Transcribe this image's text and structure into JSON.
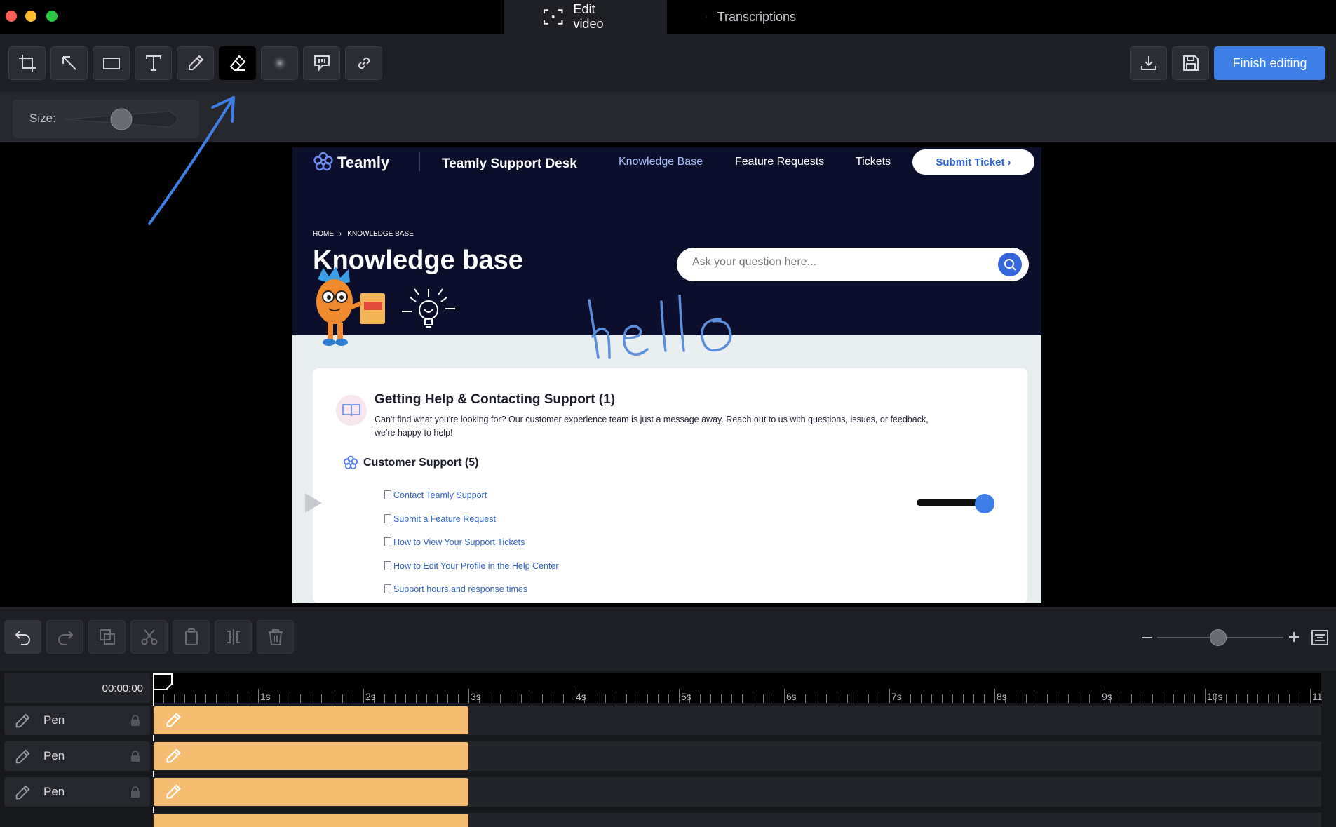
{
  "window": {
    "tabs": [
      {
        "label": "Edit video",
        "icon": "screen-capture-icon",
        "active": true
      },
      {
        "label": "Transcriptions",
        "icon": "transcript-icon",
        "active": false
      }
    ]
  },
  "toolbar": {
    "tools": [
      "crop-icon",
      "arrow-icon",
      "rectangle-icon",
      "text-icon",
      "pen-icon",
      "eraser-icon",
      "blur-icon",
      "callout-icon",
      "link-icon"
    ],
    "active_tool": "eraser-icon",
    "finish_label": "Finish editing"
  },
  "size_control": {
    "label": "Size:"
  },
  "video": {
    "brand": "Teamly",
    "site_title": "Teamly Support Desk",
    "nav": [
      "Knowledge Base",
      "Feature Requests",
      "Tickets"
    ],
    "submit_label": "Submit Ticket ›",
    "breadcrumb_home": "HOME",
    "breadcrumb_sep": "›",
    "breadcrumb_current": "KNOWLEDGE BASE",
    "page_heading": "Knowledge base",
    "search_placeholder": "Ask your question here...",
    "annotation_text": "hello",
    "section": {
      "title": "Getting Help & Contacting Support (1)",
      "desc_line1": "Can't find what you're looking for? Our customer experience team is just a message away. Reach out to us with questions, issues, or feedback,",
      "desc_line2": "we're happy to help!"
    },
    "category": {
      "title": "Customer Support (5)",
      "articles": [
        "Contact Teamly Support",
        "Submit a Feature Request",
        "How to View Your Support Tickets",
        "How to Edit Your Profile in the Help Center",
        "Support hours and response times"
      ]
    }
  },
  "timeline": {
    "current_time": "00:00:00",
    "tick_labels": [
      "1s",
      "2s",
      "3s",
      "4s",
      "5s",
      "6s",
      "7s",
      "8s",
      "9s",
      "10s",
      "11"
    ],
    "tracks": [
      {
        "label": "Pen"
      },
      {
        "label": "Pen"
      },
      {
        "label": "Pen"
      }
    ]
  },
  "colors": {
    "accent": "#3d7fe6",
    "clip": "#f5bd72",
    "video_header": "#0c0f2b",
    "annotation": "#5b8fdc"
  }
}
